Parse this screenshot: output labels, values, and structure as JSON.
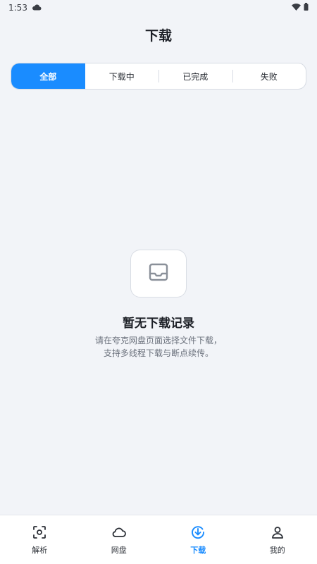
{
  "status_bar": {
    "time": "1:53",
    "icons": [
      "cloud-icon",
      "wifi-icon",
      "battery-icon"
    ]
  },
  "header": {
    "title": "下载"
  },
  "tabs": [
    {
      "label": "全部",
      "active": true
    },
    {
      "label": "下载中",
      "active": false
    },
    {
      "label": "已完成",
      "active": false
    },
    {
      "label": "失败",
      "active": false
    }
  ],
  "empty_state": {
    "icon": "inbox-icon",
    "title": "暂无下载记录",
    "description_line1": "请在夸克网盘页面选择文件下载，",
    "description_line2": "支持多线程下载与断点续传。"
  },
  "bottom_nav": [
    {
      "label": "解析",
      "icon": "scan-icon",
      "active": false
    },
    {
      "label": "网盘",
      "icon": "cloud-icon",
      "active": false
    },
    {
      "label": "下载",
      "icon": "download-icon",
      "active": true
    },
    {
      "label": "我的",
      "icon": "user-icon",
      "active": false
    }
  ],
  "colors": {
    "accent": "#1a8cff",
    "background": "#f2f4f8"
  }
}
